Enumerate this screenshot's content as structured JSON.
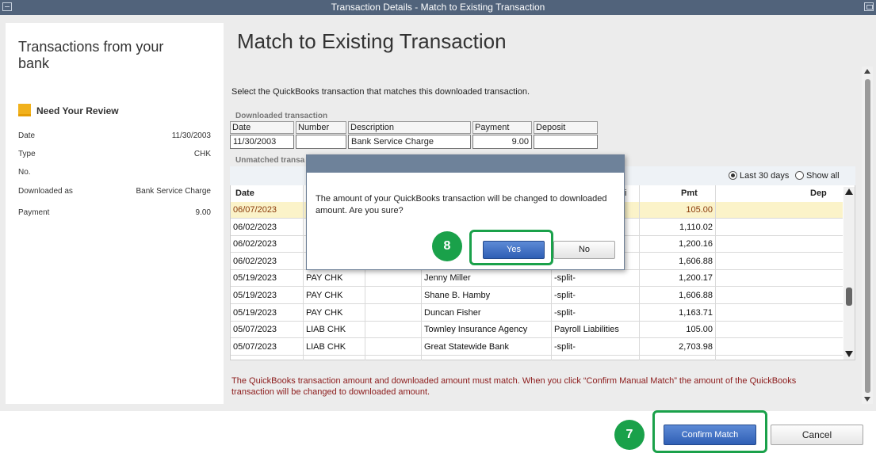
{
  "window": {
    "title": "Transaction Details - Match to Existing Transaction"
  },
  "left_panel": {
    "title": "Transactions from your bank",
    "review_label": "Need Your Review",
    "fields": [
      {
        "label": "Date",
        "value": "11/30/2003"
      },
      {
        "label": "Type",
        "value": "CHK"
      },
      {
        "label": "No.",
        "value": ""
      },
      {
        "label": "Downloaded as",
        "value": "Bank Service Charge"
      },
      {
        "label": "Payment",
        "value": "9.00"
      }
    ]
  },
  "main": {
    "heading": "Match to Existing Transaction",
    "instruction": "Select the QuickBooks transaction that matches this downloaded transaction.",
    "downloaded": {
      "section_label": "Downloaded transaction",
      "headers": {
        "date": "Date",
        "number": "Number",
        "description": "Description",
        "payment": "Payment",
        "deposit": "Deposit"
      },
      "values": {
        "date": "11/30/2003",
        "number": "",
        "description": "Bank Service Charge",
        "payment": "9.00",
        "deposit": ""
      }
    },
    "unmatched": {
      "section_label": "Unmatched transa",
      "radio_last30": "Last 30 days",
      "radio_showall": "Show all",
      "headers": {
        "date": "Date",
        "account": "i",
        "pmt": "Pmt",
        "dep": "Dep"
      },
      "rows": [
        {
          "date": "06/07/2023",
          "type": "",
          "num": "",
          "name": "",
          "account": "",
          "pmt": "105.00",
          "selected": true
        },
        {
          "date": "06/02/2023",
          "type": "",
          "num": "",
          "name": "",
          "account": "",
          "pmt": "1,110.02"
        },
        {
          "date": "06/02/2023",
          "type": "",
          "num": "",
          "name": "",
          "account": "",
          "pmt": "1,200.16"
        },
        {
          "date": "06/02/2023",
          "type": "",
          "num": "",
          "name": "",
          "account": "",
          "pmt": "1,606.88"
        },
        {
          "date": "05/19/2023",
          "type": "PAY CHK",
          "num": "",
          "name": "Jenny Miller",
          "account": "-split-",
          "pmt": "1,200.17"
        },
        {
          "date": "05/19/2023",
          "type": "PAY CHK",
          "num": "",
          "name": "Shane B. Hamby",
          "account": "-split-",
          "pmt": "1,606.88"
        },
        {
          "date": "05/19/2023",
          "type": "PAY CHK",
          "num": "",
          "name": "Duncan Fisher",
          "account": "-split-",
          "pmt": "1,163.71"
        },
        {
          "date": "05/07/2023",
          "type": "LIAB CHK",
          "num": "",
          "name": "Townley Insurance Agency",
          "account": "Payroll Liabilities",
          "pmt": "105.00"
        },
        {
          "date": "05/07/2023",
          "type": "LIAB CHK",
          "num": "",
          "name": "Great Statewide Bank",
          "account": "-split-",
          "pmt": "2,703.98"
        }
      ]
    },
    "warning": "The QuickBooks transaction amount and downloaded amount must match.  When you click “Confirm Manual Match” the amount of the QuickBooks transaction will be changed to downloaded amount."
  },
  "modal": {
    "message": "The amount of your QuickBooks transaction will be changed to downloaded amount.  Are you sure?",
    "yes_label": "Yes",
    "no_label": "No"
  },
  "footer": {
    "confirm_label": "Confirm Match",
    "cancel_label": "Cancel"
  },
  "callouts": {
    "step_yes": "8",
    "step_confirm": "7"
  },
  "colors": {
    "titlebar": "#51637b",
    "callout": "#1aa14a",
    "primary_button": "#3a6cc2",
    "warning_text": "#8b1a1a",
    "selected_row": "#fbf3c9"
  }
}
